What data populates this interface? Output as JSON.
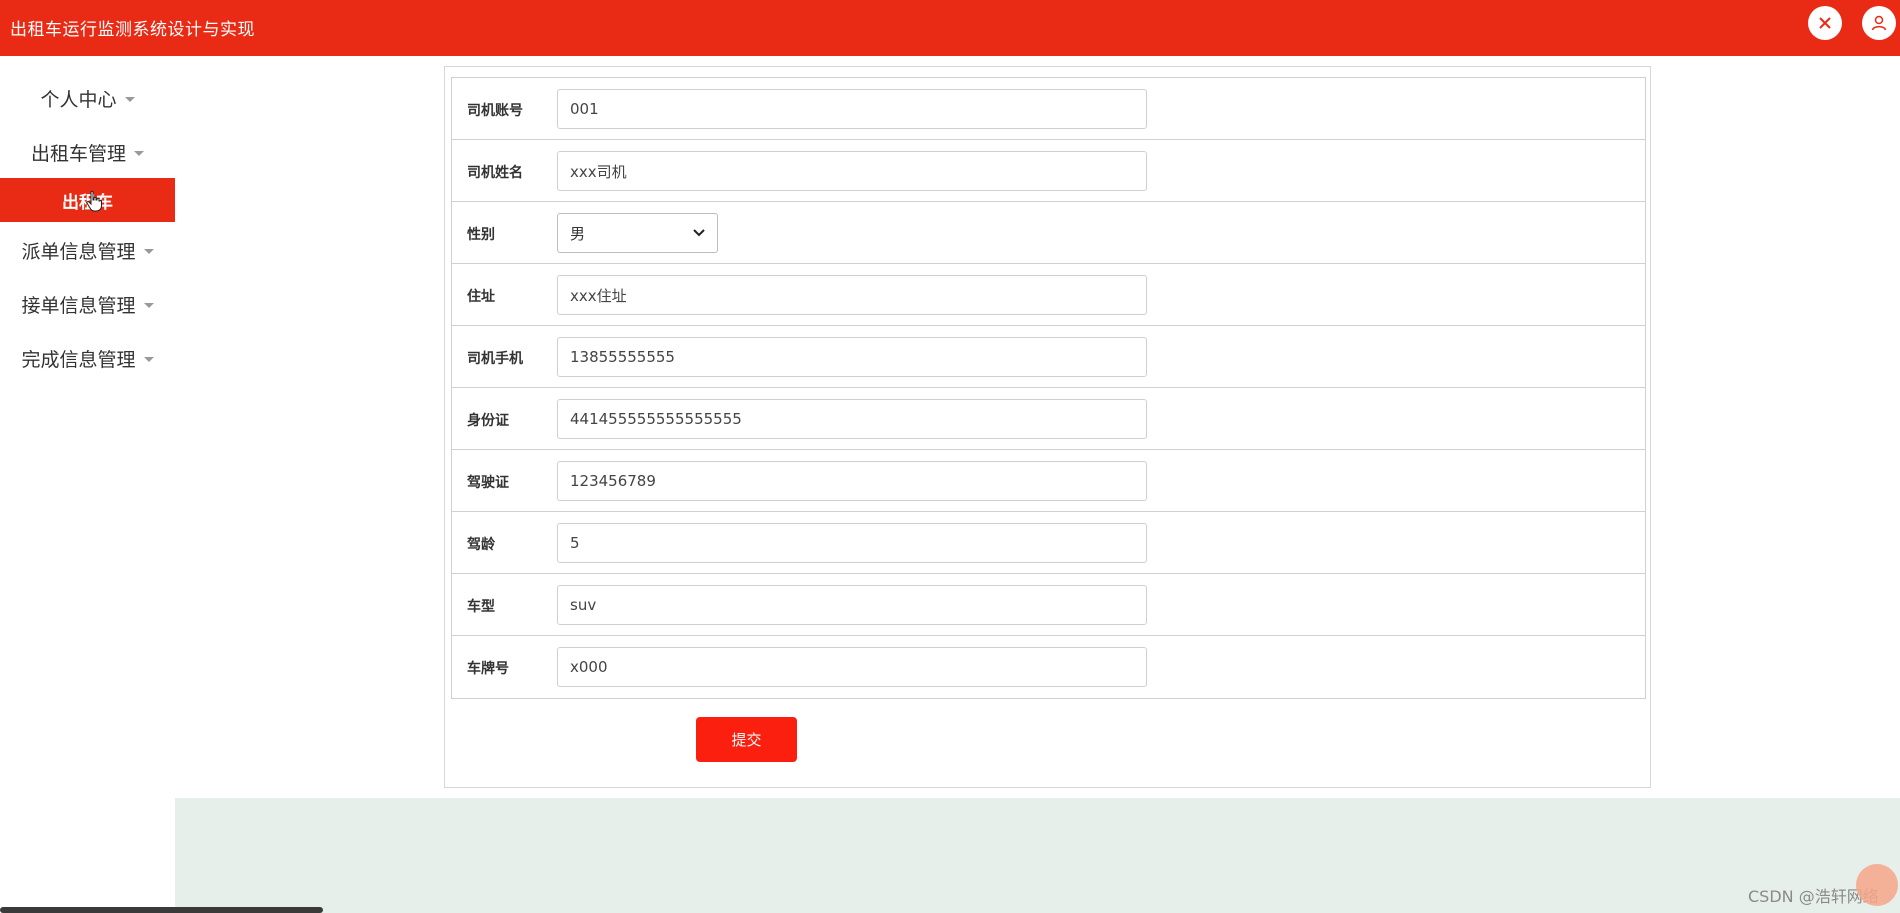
{
  "header": {
    "title": "出租车运行监测系统设计与实现",
    "icons": [
      "close-x-icon",
      "user-icon"
    ]
  },
  "sidebar": {
    "items": [
      {
        "label": "个人中心"
      },
      {
        "label": "出租车管理"
      },
      {
        "label": "派单信息管理"
      },
      {
        "label": "接单信息管理"
      },
      {
        "label": "完成信息管理"
      }
    ],
    "active_sub": "出租车"
  },
  "form": {
    "fields": [
      {
        "label": "司机账号",
        "value": "001"
      },
      {
        "label": "司机姓名",
        "value": "xxx司机"
      },
      {
        "label": "性别",
        "value": "男"
      },
      {
        "label": "住址",
        "value": "xxx住址"
      },
      {
        "label": "司机手机",
        "value": "13855555555"
      },
      {
        "label": "身份证",
        "value": "441455555555555555"
      },
      {
        "label": "驾驶证",
        "value": "123456789"
      },
      {
        "label": "驾龄",
        "value": "5"
      },
      {
        "label": "车型",
        "value": "suv"
      },
      {
        "label": "车牌号",
        "value": "x000"
      }
    ],
    "submit_label": "提交"
  },
  "watermark": "CSDN @浩轩网络",
  "colors": {
    "brand": "#e92a14",
    "submit": "#fb1f0f",
    "content_bg": "#e6efea"
  }
}
